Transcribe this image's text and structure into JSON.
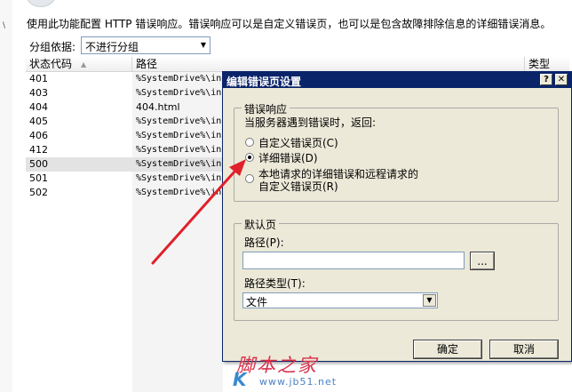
{
  "page": {
    "description": "使用此功能配置 HTTP 错误响应。错误响应可以是自定义错误页，也可以是包含故障排除信息的详细错误消息。",
    "group_by_label": "分组依据:",
    "group_by_value": "不进行分组"
  },
  "list": {
    "columns": [
      "状态代码",
      "路径",
      "类型"
    ],
    "rows": [
      {
        "code": "401",
        "path": "%SystemDrive%\\in"
      },
      {
        "code": "403",
        "path": "%SystemDrive%\\in"
      },
      {
        "code": "404",
        "path": "404.html"
      },
      {
        "code": "405",
        "path": "%SystemDrive%\\in"
      },
      {
        "code": "406",
        "path": "%SystemDrive%\\in"
      },
      {
        "code": "412",
        "path": "%SystemDrive%\\in"
      },
      {
        "code": "500",
        "path": "%SystemDrive%\\in"
      },
      {
        "code": "501",
        "path": "%SystemDrive%\\in"
      },
      {
        "code": "502",
        "path": "%SystemDrive%\\in"
      }
    ],
    "selected_code": "500"
  },
  "dialog": {
    "title": "编辑错误页设置",
    "help": "?",
    "close": "✕",
    "error_response": {
      "legend": "错误响应",
      "prompt": "当服务器遇到错误时，返回:",
      "options": [
        {
          "label": "自定义错误页(C)",
          "checked": false
        },
        {
          "label": "详细错误(D)",
          "checked": true
        },
        {
          "label_line1": "本地请求的详细错误和远程请求的",
          "label_line2": "自定义错误页(R)",
          "checked": false
        }
      ]
    },
    "default_page": {
      "legend": "默认页",
      "path_label": "路径(P):",
      "path_value": "",
      "browse": "...",
      "path_type_label": "路径类型(T):",
      "path_type_value": "文件"
    },
    "ok": "确定",
    "cancel": "取消"
  },
  "watermark": {
    "main": "脚本之家",
    "url": "www.jb51.net",
    "k": "K"
  },
  "colors": {
    "titlebar": "#0a246a",
    "dialog_bg": "#ece9d8",
    "arrow": "#e0202a",
    "selected_row": "#e3e3e3"
  },
  "icons": {
    "sort": "triangle-up",
    "dropdown": "triangle-down"
  }
}
